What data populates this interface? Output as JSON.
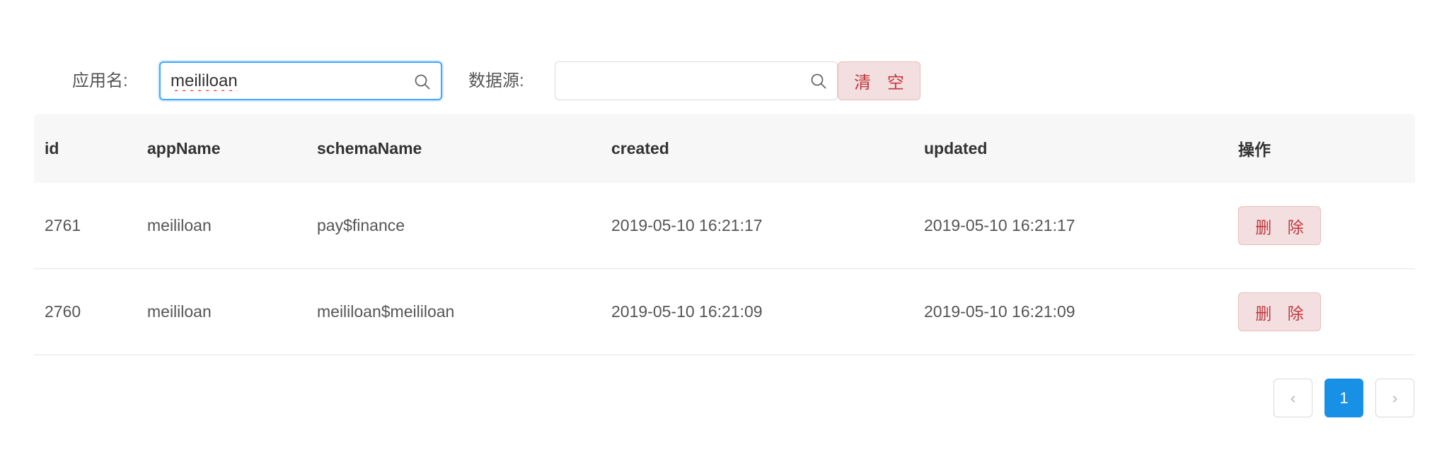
{
  "filters": {
    "app_name_label": "应用名:",
    "app_name_value": "meililoan",
    "datasource_label": "数据源:",
    "datasource_value": "",
    "clear_label": "清 空"
  },
  "table": {
    "columns": [
      "id",
      "appName",
      "schemaName",
      "created",
      "updated",
      "操作"
    ],
    "rows": [
      {
        "id": "2761",
        "appName": "meililoan",
        "schemaName": "pay$finance",
        "created": "2019-05-10 16:21:17",
        "updated": "2019-05-10 16:21:17",
        "action_label": "删 除"
      },
      {
        "id": "2760",
        "appName": "meililoan",
        "schemaName": "meililoan$meililoan",
        "created": "2019-05-10 16:21:09",
        "updated": "2019-05-10 16:21:09",
        "action_label": "删 除"
      }
    ]
  },
  "pagination": {
    "prev_icon": "chevron-left-icon",
    "prev_glyph": "‹",
    "current_page": "1",
    "next_icon": "chevron-right-icon",
    "next_glyph": "›"
  },
  "colors": {
    "accent": "#1890e6",
    "danger_text": "#c0383e",
    "danger_bg": "#f3dfe0",
    "focus_border": "#40a9ff"
  }
}
